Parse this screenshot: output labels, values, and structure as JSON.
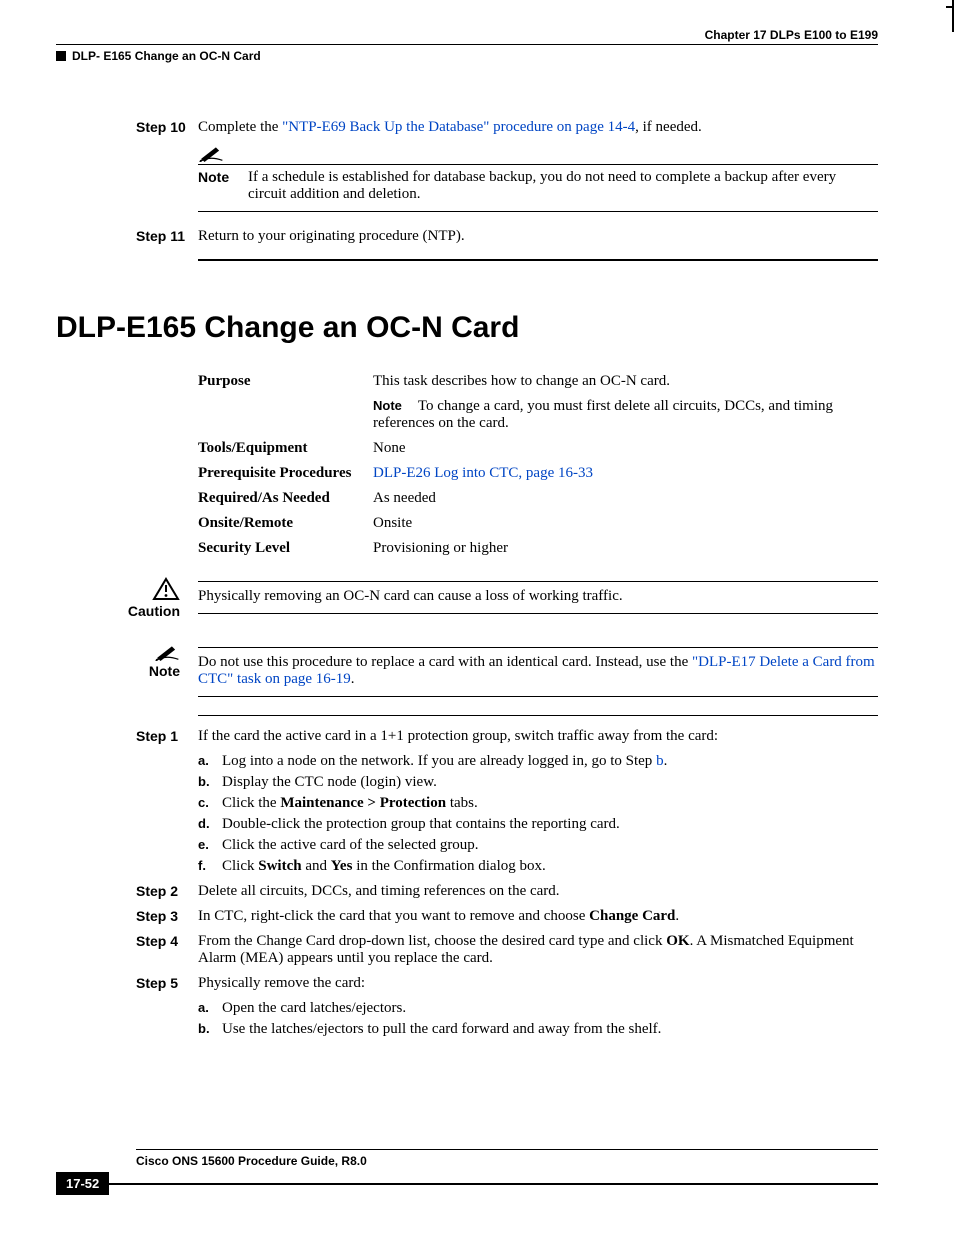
{
  "header": {
    "chapter": "Chapter 17      DLPs E100 to E199",
    "section": "DLP- E165 Change an OC-N Card"
  },
  "top_steps": {
    "s10": {
      "label": "Step 10",
      "pre": "Complete the ",
      "link": "\"NTP-E69 Back Up the Database\" procedure on page 14-4",
      "post": ", if needed."
    },
    "note": {
      "label": "Note",
      "text": "If a schedule is established for database backup, you do not need to complete a backup after every circuit addition and deletion."
    },
    "s11": {
      "label": "Step 11",
      "text": "Return to your originating procedure (NTP)."
    }
  },
  "title": "DLP-E165 Change an OC-N Card",
  "meta": {
    "purpose": {
      "k": "Purpose",
      "v": "This task describes how to change an OC-N card."
    },
    "purpose_note": {
      "label": "Note",
      "text": "To change a card, you must first delete all circuits, DCCs, and timing references on the card."
    },
    "tools": {
      "k": "Tools/Equipment",
      "v": "None"
    },
    "prereq": {
      "k": "Prerequisite Procedures",
      "link": "DLP-E26 Log into CTC, page 16-33"
    },
    "required": {
      "k": "Required/As Needed",
      "v": "As needed"
    },
    "onsite": {
      "k": "Onsite/Remote",
      "v": "Onsite"
    },
    "security": {
      "k": "Security Level",
      "v": "Provisioning or higher"
    }
  },
  "caution": {
    "label": "Caution",
    "text": "Physically removing an OC-N card can cause a loss of working traffic."
  },
  "note2": {
    "label": "Note",
    "pre": "Do not use this procedure to replace a card with an identical card. Instead, use the ",
    "link": "\"DLP-E17 Delete a Card from CTC\" task on page 16-19",
    "post": "."
  },
  "steps": [
    {
      "label": "Step 1",
      "text": "If the card the active card in a 1+1 protection group, switch traffic away from the card:",
      "sub": [
        {
          "lit": "a.",
          "pre": "Log into a node on the network. If you are already logged in, go to Step ",
          "link": "b",
          "post": "."
        },
        {
          "lit": "b.",
          "text": "Display the CTC node (login) view."
        },
        {
          "lit": "c.",
          "pre": "Click the ",
          "b1": "Maintenance > Protection",
          "post": " tabs."
        },
        {
          "lit": "d.",
          "text": "Double-click the protection group that contains the reporting card."
        },
        {
          "lit": "e.",
          "text": "Click the active card of the selected group."
        },
        {
          "lit": "f.",
          "pre": "Click ",
          "b1": "Switch",
          "mid": " and ",
          "b2": "Yes",
          "post": " in the Confirmation dialog box."
        }
      ]
    },
    {
      "label": "Step 2",
      "text": "Delete all circuits, DCCs, and timing references on the card."
    },
    {
      "label": "Step 3",
      "pre": "In CTC, right-click the card that you want to remove and choose ",
      "b1": "Change Card",
      "post": "."
    },
    {
      "label": "Step 4",
      "pre": "From the Change Card drop-down list, choose the desired card type and click ",
      "b1": "OK",
      "post": ". A Mismatched Equipment Alarm (MEA) appears until you replace the card."
    },
    {
      "label": "Step 5",
      "text": "Physically remove the card:",
      "sub": [
        {
          "lit": "a.",
          "text": "Open the card latches/ejectors."
        },
        {
          "lit": "b.",
          "text": "Use the latches/ejectors to pull the card forward and away from the shelf."
        }
      ]
    }
  ],
  "footer": {
    "book": "Cisco ONS 15600 Procedure Guide, R8.0",
    "page": "17-52"
  }
}
